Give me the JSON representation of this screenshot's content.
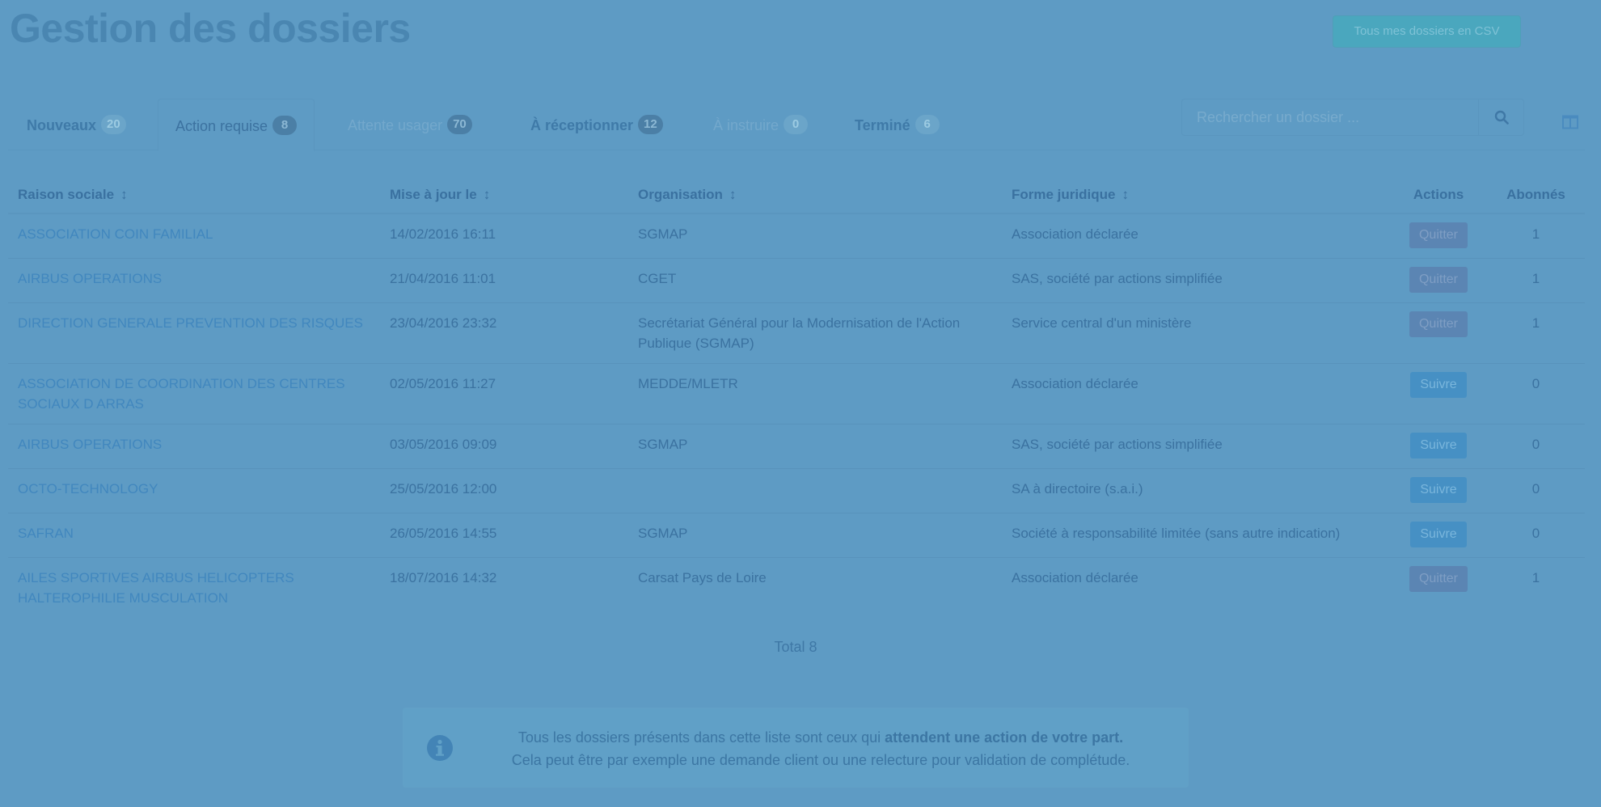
{
  "header": {
    "title": "Gestion des dossiers",
    "csv_button": "Tous mes dossiers en CSV"
  },
  "tabs": [
    {
      "label": "Nouveaux",
      "count": "20"
    },
    {
      "label": "Action requise",
      "count": "8"
    },
    {
      "label": "Attente usager",
      "count": "70"
    },
    {
      "label": "À réceptionner",
      "count": "12"
    },
    {
      "label": "À instruire",
      "count": "0"
    },
    {
      "label": "Terminé",
      "count": "6"
    }
  ],
  "search": {
    "placeholder": "Rechercher un dossier ..."
  },
  "table": {
    "headers": {
      "raison_sociale": "Raison sociale",
      "mise_a_jour": "Mise à jour le",
      "organisation": "Organisation",
      "forme_juridique": "Forme juridique",
      "actions": "Actions",
      "abonnes": "Abonnés"
    },
    "rows": [
      {
        "raison": "ASSOCIATION COIN FAMILIAL",
        "date": "14/02/2016 16:11",
        "organisation": "SGMAP",
        "forme": "Association déclarée",
        "action": "Quitter",
        "abonnes": "1"
      },
      {
        "raison": "AIRBUS OPERATIONS",
        "date": "21/04/2016 11:01",
        "organisation": "CGET",
        "forme": "SAS, société par actions simplifiée",
        "action": "Quitter",
        "abonnes": "1"
      },
      {
        "raison": "DIRECTION GENERALE PREVENTION DES RISQUES",
        "date": "23/04/2016 23:32",
        "organisation": "Secrétariat Général pour la Modernisation de l'Action Publique (SGMAP)",
        "forme": "Service central d'un ministère",
        "action": "Quitter",
        "abonnes": "1"
      },
      {
        "raison": "ASSOCIATION DE COORDINATION DES CENTRES SOCIAUX D ARRAS",
        "date": "02/05/2016 11:27",
        "organisation": "MEDDE/MLETR",
        "forme": "Association déclarée",
        "action": "Suivre",
        "abonnes": "0"
      },
      {
        "raison": "AIRBUS OPERATIONS",
        "date": "03/05/2016 09:09",
        "organisation": "SGMAP",
        "forme": "SAS, société par actions simplifiée",
        "action": "Suivre",
        "abonnes": "0"
      },
      {
        "raison": "OCTO-TECHNOLOGY",
        "date": "25/05/2016 12:00",
        "organisation": "",
        "forme": "SA à directoire (s.a.i.)",
        "action": "Suivre",
        "abonnes": "0"
      },
      {
        "raison": "SAFRAN",
        "date": "26/05/2016 14:55",
        "organisation": "SGMAP",
        "forme": "Société à responsabilité limitée (sans autre indication)",
        "action": "Suivre",
        "abonnes": "0"
      },
      {
        "raison": "AILES SPORTIVES AIRBUS HELICOPTERS HALTEROPHILIE MUSCULATION",
        "date": "18/07/2016 14:32",
        "organisation": "Carsat Pays de Loire",
        "forme": "Association déclarée",
        "action": "Quitter",
        "abonnes": "1"
      }
    ]
  },
  "total": "Total 8",
  "info": {
    "text_before": "Tous les dossiers présents dans cette liste sont ceux qui ",
    "text_bold": "attendent une action de votre part.",
    "line2": "Cela peut être par exemple une demande client ou une relecture pour validation de complétude."
  },
  "icons": {
    "search": "search-icon",
    "columns": "columns-icon",
    "sort": "sort-icon",
    "info": "info-icon"
  },
  "colors": {
    "background": "#5e9bc4",
    "link": "#4187be",
    "quitter_button": "#5b85b3",
    "suivre_button": "#4690c4",
    "csv_button": "#4aa7be"
  }
}
